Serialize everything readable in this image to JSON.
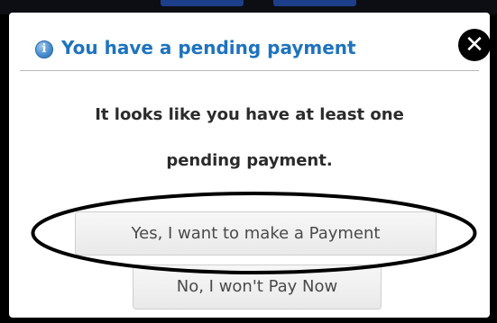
{
  "dialog": {
    "title": "You have a pending payment",
    "message_line1": "It looks like you have at least one",
    "message_line2": "pending payment.",
    "info_icon": {
      "name": "info-icon",
      "glyph": "i",
      "color": "#4a8fd1"
    },
    "close_icon": {
      "name": "close-icon",
      "glyph": "✕"
    },
    "buttons": {
      "yes": "Yes, I want to make a Payment",
      "no": "No, I won't Pay Now"
    }
  },
  "colors": {
    "title": "#1e73be",
    "message": "#2b2b2b",
    "button_text": "#4a4a4a",
    "annotation": "#000000"
  }
}
